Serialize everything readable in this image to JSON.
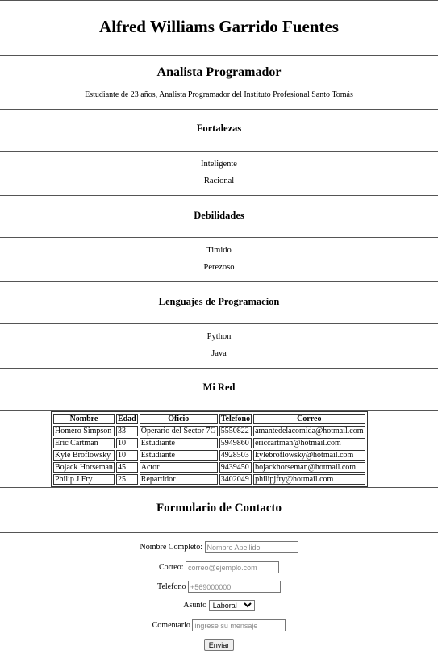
{
  "header": {
    "name": "Alfred Williams Garrido Fuentes",
    "role": "Analista Programador",
    "description": "Estudiante de 23 años, Analista Programador del Instituto Profesional Santo Tomás"
  },
  "fortalezas": {
    "heading": "Fortalezas",
    "items": [
      "Inteligente",
      "Racional"
    ]
  },
  "debilidades": {
    "heading": "Debilidades",
    "items": [
      "Timido",
      "Perezoso"
    ]
  },
  "lenguajes": {
    "heading": "Lenguajes de Programacion",
    "items": [
      "Python",
      "Java"
    ]
  },
  "red": {
    "heading": "Mi Red",
    "columns": [
      "Nombre",
      "Edad",
      "Oficio",
      "Telefono",
      "Correo"
    ],
    "rows": [
      [
        "Homero Simpson",
        "33",
        "Operario del Sector 7G",
        "5550822",
        "amantedelacomida@hotmail.com"
      ],
      [
        "Eric Cartman",
        "10",
        "Estudiante",
        "5949860",
        "ericcartman@hotmail.com"
      ],
      [
        "Kyle Broflowsky",
        "10",
        "Estudiante",
        "4928503",
        "kylebroflowsky@hotmail.com"
      ],
      [
        "Bojack Horseman",
        "45",
        "Actor",
        "9439450",
        "bojackhorseman@hotmail.com"
      ],
      [
        "Philip J Fry",
        "25",
        "Repartidor",
        "3402049",
        "philipjfry@hotmail.com"
      ]
    ]
  },
  "form": {
    "heading": "Formulario de Contacto",
    "name_label": "Nombre Completo:",
    "name_placeholder": "Nombre Apellido",
    "email_label": "Correo:",
    "email_placeholder": "correo@ejemplo.com",
    "phone_label": "Telefono",
    "phone_placeholder": "+569000000",
    "subject_label": "Asunto",
    "subject_value": "Laboral",
    "comment_label": "Comentario",
    "comment_placeholder": "ingrese su mensaje",
    "submit_label": "Enviar"
  }
}
